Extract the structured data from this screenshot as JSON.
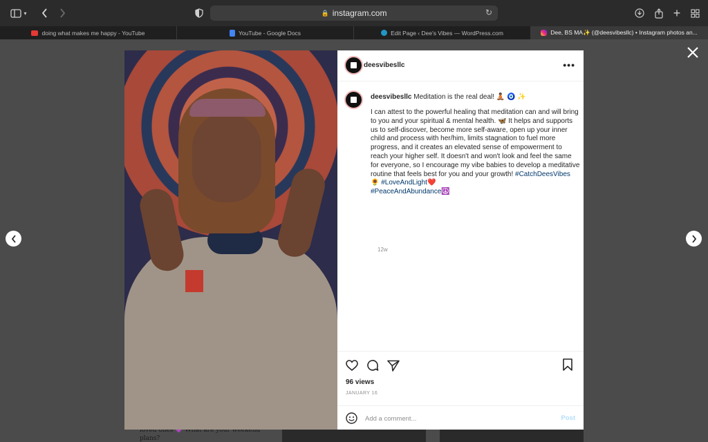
{
  "browser": {
    "url": "instagram.com",
    "tabs": [
      {
        "label": "doing what makes me happy - YouTube",
        "favicon": "youtube-icon"
      },
      {
        "label": "YouTube - Google Docs",
        "favicon": "google-docs-icon"
      },
      {
        "label": "Edit Page ‹ Dee's Vibes — WordPress.com",
        "favicon": "wordpress-icon"
      },
      {
        "label": "Dee, BS MA✨ (@deesvibesllc) • Instagram photos an...",
        "favicon": "instagram-icon"
      }
    ],
    "active_tab": 3
  },
  "post": {
    "username": "deesvibesllc",
    "caption_first_line": "Meditation is the real deal! 🧘🏾 🧿 ✨",
    "caption_body_1": "I can attest to the powerful healing that meditation can and will bring to you and your spiritual & mental health. 🦋 It helps and supports us to self-discover, become more self-aware, open up your inner child and process with her/him, limits stagnation to fuel more progress, and it creates an elevated sense of empowerment to reach your higher self. It doesn't and won't look and feel the same for everyone, so I encourage my vibe babies to develop a meditative routine that feels best for you and your growth! ",
    "hashtag_1": "#CatchDeesVibes",
    "emoji_1": " 🌻 ",
    "hashtag_2": "#LoveAndLight",
    "emoji_2": "❤️",
    "hashtag_3": "#PeaceAndAbundance",
    "emoji_3": "☮️",
    "time_ago": "12w",
    "views": "96 views",
    "date": "JANUARY 16",
    "comment_placeholder": "Add a comment...",
    "post_label": "Post"
  },
  "background": {
    "snippet": "loved ones 💜 What are your weekend plans?"
  },
  "colors": {
    "hashtag": "#00376b",
    "post_disabled": "#b2dffc",
    "overlay": "#4b4b4b"
  }
}
